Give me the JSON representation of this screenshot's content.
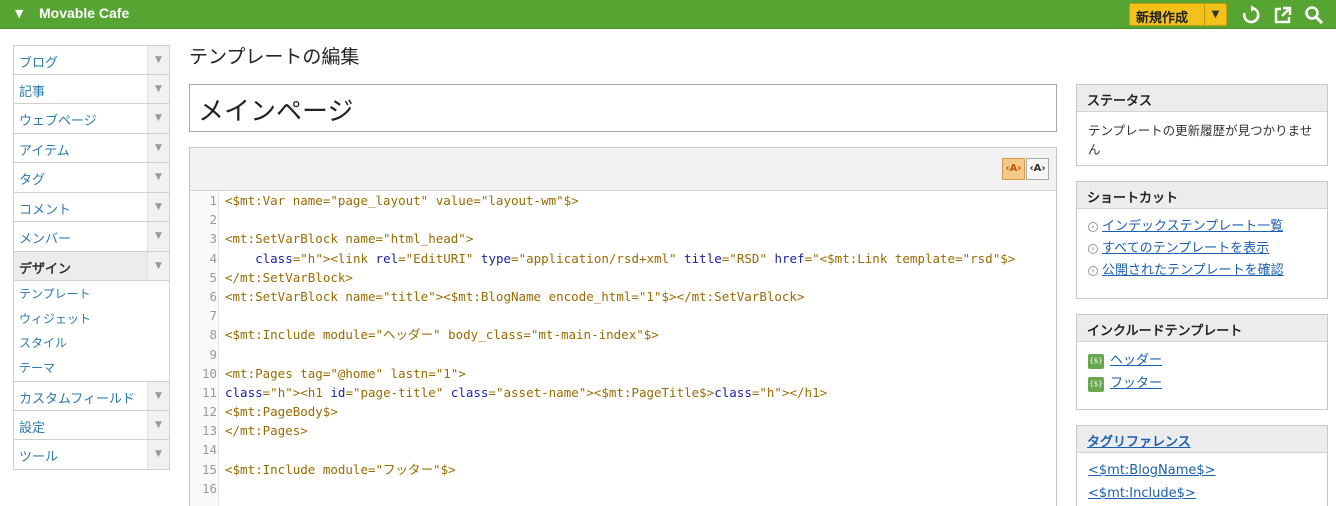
{
  "header": {
    "site_name": "Movable Cafe",
    "new_button_label": "新規作成"
  },
  "sidebar": {
    "items": [
      {
        "label": "ブログ"
      },
      {
        "label": "記事"
      },
      {
        "label": "ウェブページ"
      },
      {
        "label": "アイテム"
      },
      {
        "label": "タグ"
      },
      {
        "label": "コメント"
      },
      {
        "label": "メンバー"
      },
      {
        "label": "デザイン"
      },
      {
        "label": "カスタムフィールド"
      },
      {
        "label": "設定"
      },
      {
        "label": "ツール"
      }
    ],
    "design_subitems": [
      {
        "label": "テンプレート"
      },
      {
        "label": "ウィジェット"
      },
      {
        "label": "スタイル"
      },
      {
        "label": "テーマ"
      }
    ]
  },
  "main": {
    "page_title": "テンプレートの編集",
    "template_name": "メインページ"
  },
  "code_lines": [
    {
      "n": "1",
      "text": "<$mt:Var name=\"page_layout\" value=\"layout-wm\"$>"
    },
    {
      "n": "2",
      "text": ""
    },
    {
      "n": "3",
      "text": "<mt:SetVarBlock name=\"html_head\">"
    },
    {
      "n": "4",
      "text": "    <link rel=\"EditURI\" type=\"application/rsd+xml\" title=\"RSD\" href=\"<$mt:Link template=\"rsd\"$>"
    },
    {
      "n": "5",
      "text": "</mt:SetVarBlock>"
    },
    {
      "n": "6",
      "text": "<mt:SetVarBlock name=\"title\"><$mt:BlogName encode_html=\"1\"$></mt:SetVarBlock>"
    },
    {
      "n": "7",
      "text": ""
    },
    {
      "n": "8",
      "text": "<$mt:Include module=\"ヘッダー\" body_class=\"mt-main-index\"$>"
    },
    {
      "n": "9",
      "text": ""
    },
    {
      "n": "10",
      "text": "<mt:Pages tag=\"@home\" lastn=\"1\">"
    },
    {
      "n": "11",
      "text": "<h1 id=\"page-title\" class=\"asset-name\"><$mt:PageTitle$></h1>"
    },
    {
      "n": "12",
      "text": "<$mt:PageBody$>"
    },
    {
      "n": "13",
      "text": "</mt:Pages>"
    },
    {
      "n": "14",
      "text": ""
    },
    {
      "n": "15",
      "text": "<$mt:Include module=\"フッター\"$>"
    },
    {
      "n": "16",
      "text": ""
    }
  ],
  "status_widget": {
    "title": "ステータス",
    "body": "テンプレートの更新履歴が見つかりません"
  },
  "shortcut_widget": {
    "title": "ショートカット",
    "links": [
      {
        "label": "インデックステンプレート一覧"
      },
      {
        "label": "すべてのテンプレートを表示"
      },
      {
        "label": "公開されたテンプレートを確認"
      }
    ]
  },
  "include_widget": {
    "title": "インクルードテンプレート",
    "links": [
      {
        "label": "ヘッダー"
      },
      {
        "label": "フッター"
      }
    ]
  },
  "tagref_widget": {
    "title": "タグリファレンス",
    "links": [
      {
        "label": "<$mt:BlogName$>"
      },
      {
        "label": "<$mt:Include$>"
      }
    ]
  },
  "colors": {
    "topbar": "#56a431",
    "new_button": "#f2c21a",
    "link": "#1a5fb4"
  }
}
